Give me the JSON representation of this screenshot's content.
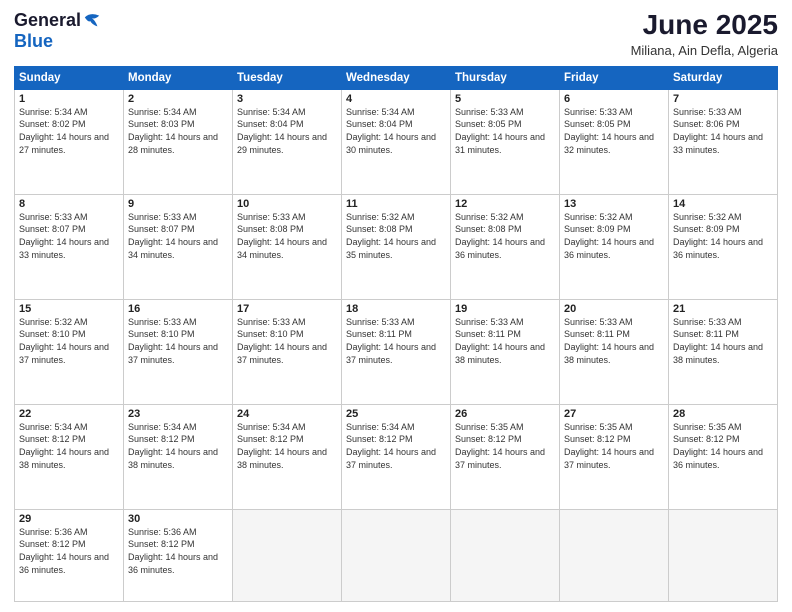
{
  "logo": {
    "general": "General",
    "blue": "Blue"
  },
  "header": {
    "month": "June 2025",
    "location": "Miliana, Ain Defla, Algeria"
  },
  "weekdays": [
    "Sunday",
    "Monday",
    "Tuesday",
    "Wednesday",
    "Thursday",
    "Friday",
    "Saturday"
  ],
  "weeks": [
    [
      {
        "day": "1",
        "sunrise": "5:34 AM",
        "sunset": "8:02 PM",
        "daylight": "14 hours and 27 minutes."
      },
      {
        "day": "2",
        "sunrise": "5:34 AM",
        "sunset": "8:03 PM",
        "daylight": "14 hours and 28 minutes."
      },
      {
        "day": "3",
        "sunrise": "5:34 AM",
        "sunset": "8:04 PM",
        "daylight": "14 hours and 29 minutes."
      },
      {
        "day": "4",
        "sunrise": "5:34 AM",
        "sunset": "8:04 PM",
        "daylight": "14 hours and 30 minutes."
      },
      {
        "day": "5",
        "sunrise": "5:33 AM",
        "sunset": "8:05 PM",
        "daylight": "14 hours and 31 minutes."
      },
      {
        "day": "6",
        "sunrise": "5:33 AM",
        "sunset": "8:05 PM",
        "daylight": "14 hours and 32 minutes."
      },
      {
        "day": "7",
        "sunrise": "5:33 AM",
        "sunset": "8:06 PM",
        "daylight": "14 hours and 33 minutes."
      }
    ],
    [
      {
        "day": "8",
        "sunrise": "5:33 AM",
        "sunset": "8:07 PM",
        "daylight": "14 hours and 33 minutes."
      },
      {
        "day": "9",
        "sunrise": "5:33 AM",
        "sunset": "8:07 PM",
        "daylight": "14 hours and 34 minutes."
      },
      {
        "day": "10",
        "sunrise": "5:33 AM",
        "sunset": "8:08 PM",
        "daylight": "14 hours and 34 minutes."
      },
      {
        "day": "11",
        "sunrise": "5:32 AM",
        "sunset": "8:08 PM",
        "daylight": "14 hours and 35 minutes."
      },
      {
        "day": "12",
        "sunrise": "5:32 AM",
        "sunset": "8:08 PM",
        "daylight": "14 hours and 36 minutes."
      },
      {
        "day": "13",
        "sunrise": "5:32 AM",
        "sunset": "8:09 PM",
        "daylight": "14 hours and 36 minutes."
      },
      {
        "day": "14",
        "sunrise": "5:32 AM",
        "sunset": "8:09 PM",
        "daylight": "14 hours and 36 minutes."
      }
    ],
    [
      {
        "day": "15",
        "sunrise": "5:32 AM",
        "sunset": "8:10 PM",
        "daylight": "14 hours and 37 minutes."
      },
      {
        "day": "16",
        "sunrise": "5:33 AM",
        "sunset": "8:10 PM",
        "daylight": "14 hours and 37 minutes."
      },
      {
        "day": "17",
        "sunrise": "5:33 AM",
        "sunset": "8:10 PM",
        "daylight": "14 hours and 37 minutes."
      },
      {
        "day": "18",
        "sunrise": "5:33 AM",
        "sunset": "8:11 PM",
        "daylight": "14 hours and 37 minutes."
      },
      {
        "day": "19",
        "sunrise": "5:33 AM",
        "sunset": "8:11 PM",
        "daylight": "14 hours and 38 minutes."
      },
      {
        "day": "20",
        "sunrise": "5:33 AM",
        "sunset": "8:11 PM",
        "daylight": "14 hours and 38 minutes."
      },
      {
        "day": "21",
        "sunrise": "5:33 AM",
        "sunset": "8:11 PM",
        "daylight": "14 hours and 38 minutes."
      }
    ],
    [
      {
        "day": "22",
        "sunrise": "5:34 AM",
        "sunset": "8:12 PM",
        "daylight": "14 hours and 38 minutes."
      },
      {
        "day": "23",
        "sunrise": "5:34 AM",
        "sunset": "8:12 PM",
        "daylight": "14 hours and 38 minutes."
      },
      {
        "day": "24",
        "sunrise": "5:34 AM",
        "sunset": "8:12 PM",
        "daylight": "14 hours and 38 minutes."
      },
      {
        "day": "25",
        "sunrise": "5:34 AM",
        "sunset": "8:12 PM",
        "daylight": "14 hours and 37 minutes."
      },
      {
        "day": "26",
        "sunrise": "5:35 AM",
        "sunset": "8:12 PM",
        "daylight": "14 hours and 37 minutes."
      },
      {
        "day": "27",
        "sunrise": "5:35 AM",
        "sunset": "8:12 PM",
        "daylight": "14 hours and 37 minutes."
      },
      {
        "day": "28",
        "sunrise": "5:35 AM",
        "sunset": "8:12 PM",
        "daylight": "14 hours and 36 minutes."
      }
    ],
    [
      {
        "day": "29",
        "sunrise": "5:36 AM",
        "sunset": "8:12 PM",
        "daylight": "14 hours and 36 minutes."
      },
      {
        "day": "30",
        "sunrise": "5:36 AM",
        "sunset": "8:12 PM",
        "daylight": "14 hours and 36 minutes."
      },
      null,
      null,
      null,
      null,
      null
    ]
  ]
}
